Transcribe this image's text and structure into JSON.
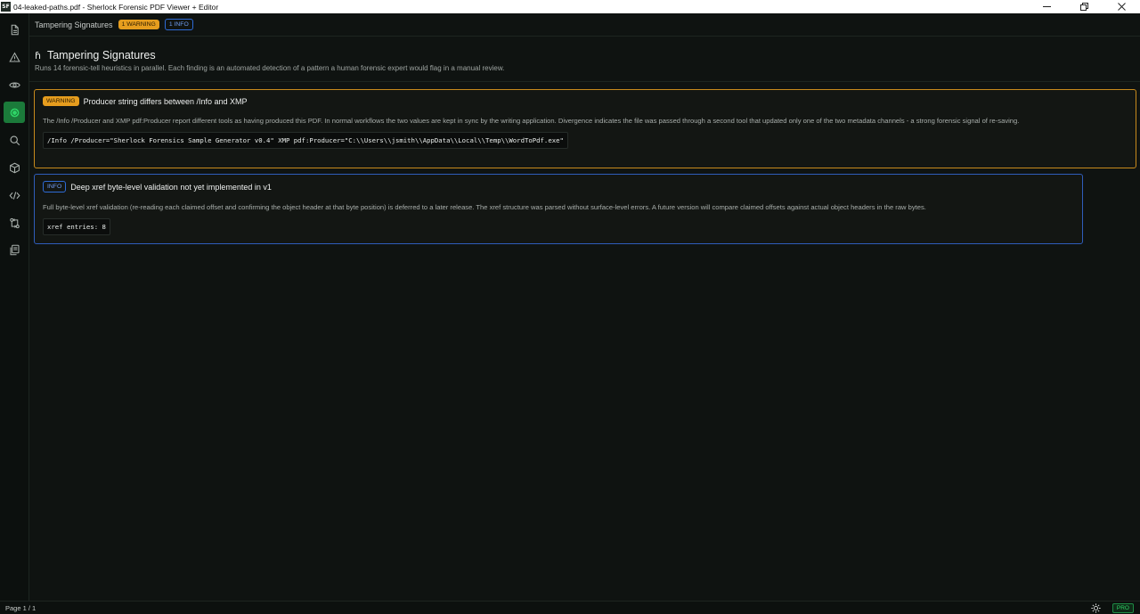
{
  "window": {
    "logo_text": "SF",
    "title": "04-leaked-paths.pdf - Sherlock Forensic PDF Viewer + Editor",
    "controls": [
      "minimize-icon",
      "maximize-icon",
      "close-icon"
    ]
  },
  "sidebar": {
    "items": [
      {
        "name": "document",
        "icon": "document-icon",
        "active": false
      },
      {
        "name": "warnings",
        "icon": "warning-triangle-icon",
        "active": false
      },
      {
        "name": "visibility",
        "icon": "eye-icon",
        "active": false
      },
      {
        "name": "tampering",
        "icon": "fingerprint-icon",
        "active": true
      },
      {
        "name": "search",
        "icon": "search-icon",
        "active": false
      },
      {
        "name": "objects",
        "icon": "cube-icon",
        "active": false
      },
      {
        "name": "source",
        "icon": "code-icon",
        "active": false
      },
      {
        "name": "compare",
        "icon": "git-compare-icon",
        "active": false
      },
      {
        "name": "pages",
        "icon": "copy-icon",
        "active": false
      }
    ],
    "accent_color": "#1b7a3a"
  },
  "topbar": {
    "title": "Tampering Signatures",
    "warning_badge": "1 WARNING",
    "info_badge": "1 INFO"
  },
  "main": {
    "heading_icon": "fingerprint-icon",
    "heading_glyph": "ɦ",
    "heading": "Tampering Signatures",
    "subtitle": "Runs 14 forensic-tell heuristics in parallel. Each finding is an automated detection of a pattern a human forensic expert would flag in a manual review.",
    "findings": [
      {
        "severity": "WARNING",
        "severity_color": "#e69d1e",
        "title": "Producer string differs between /Info and XMP",
        "description": "The /Info /Producer and XMP pdf:Producer report different tools as having produced this PDF. In normal workflows the two values are kept in sync by the writing application. Divergence indicates the file was passed through a second tool that updated only one of the two metadata channels - a strong forensic signal of re-saving.",
        "evidence": "/Info /Producer=\"Sherlock Forensics Sample Generator v0.4\" XMP pdf:Producer=\"C:\\\\Users\\\\jsmith\\\\AppData\\\\Local\\\\Temp\\\\WordToPdf.exe\""
      },
      {
        "severity": "INFO",
        "severity_color": "#2e6bd6",
        "title": "Deep xref byte-level validation not yet implemented in v1",
        "description": "Full byte-level xref validation (re-reading each claimed offset and confirming the object header at that byte position) is deferred to a later release. The xref structure was parsed without surface-level errors. A future version will compare claimed offsets against actual object headers in the raw bytes.",
        "evidence": "xref entries: 8"
      }
    ]
  },
  "statusbar": {
    "page_indicator": "Page 1 / 1",
    "theme_icon": "sun-icon",
    "pro_badge": "PRO"
  }
}
